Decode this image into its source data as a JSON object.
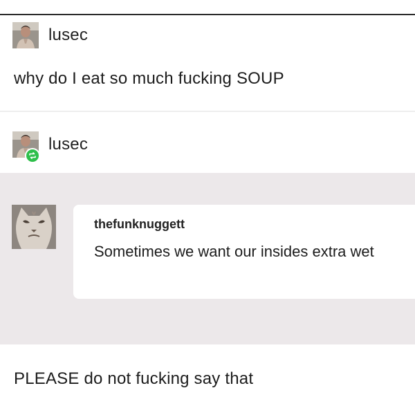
{
  "colors": {
    "background": "#ffffff",
    "ask_background": "#ece8ea",
    "reblog_badge": "#2fbf4b",
    "text": "#1c1c1c"
  },
  "post": {
    "author": "lusec",
    "avatar_icon": "user-photo-avatar",
    "text": "why do I eat so much fucking SOUP"
  },
  "reblog": {
    "author": "lusec",
    "avatar_icon": "user-photo-avatar",
    "badge_icon": "reblog-icon",
    "ask": {
      "asker": "thefunknuggett",
      "asker_avatar_icon": "cat-photo-avatar",
      "text": "Sometimes we want our insides extra wet"
    },
    "reply": "PLEASE do not fucking say that"
  }
}
